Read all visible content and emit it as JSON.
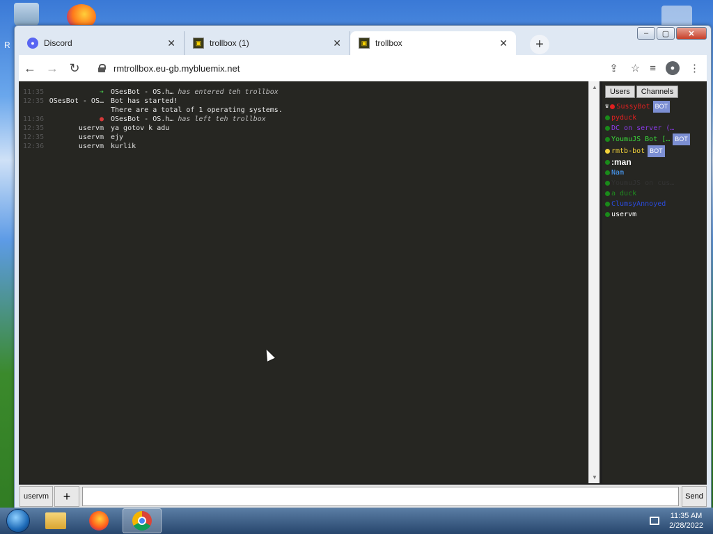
{
  "desktop": {
    "left_letter": "R"
  },
  "browser": {
    "tabs": [
      {
        "title": "Discord",
        "icon": "discord-icon"
      },
      {
        "title": "trollbox (1)",
        "icon": "trollbox-icon"
      },
      {
        "title": "trollbox",
        "icon": "trollbox-icon"
      }
    ],
    "url": "rmtrollbox.eu-gb.mybluemix.net",
    "window_controls": {
      "minimize": "–",
      "maximize": "▢",
      "close": "✕"
    }
  },
  "chat": {
    "messages": [
      {
        "time": "11:35",
        "nick": "➔",
        "text": "OSesBot - OS.h…",
        "suffix": "has entered teh trollbox",
        "type": "join"
      },
      {
        "time": "12:35",
        "nick": "OSesBot - OS…",
        "text": "Bot has started!",
        "suffix": "",
        "type": "msg"
      },
      {
        "time": "",
        "nick": "",
        "text": "There are a total of 1 operating systems.",
        "suffix": "",
        "type": "msg"
      },
      {
        "time": "11:36",
        "nick": "●",
        "text": "OSesBot - OS.h…",
        "suffix": "has left teh trollbox",
        "type": "leave"
      },
      {
        "time": "12:35",
        "nick": "uservm",
        "text": "ya gotov k adu",
        "suffix": "",
        "type": "msg"
      },
      {
        "time": "12:35",
        "nick": "uservm",
        "text": "ejy",
        "suffix": "",
        "type": "msg"
      },
      {
        "time": "12:36",
        "nick": "uservm",
        "text": "kurlik",
        "suffix": "",
        "type": "msg"
      }
    ]
  },
  "sidebar": {
    "tabs": [
      "Users",
      "Channels"
    ],
    "users": [
      {
        "name": "SussyBot",
        "color": "#e02020",
        "dot": "#e02020",
        "bot": true,
        "crown": true
      },
      {
        "name": "pyduck",
        "color": "#e02020",
        "dot": "#1a8a1a",
        "bot": false
      },
      {
        "name": "DC on server (…",
        "color": "#8a3ae8",
        "dot": "#1a8a1a",
        "bot": false
      },
      {
        "name": "YoumuJS Bot […",
        "color": "#3ad83a",
        "dot": "#1a8a1a",
        "bot": true
      },
      {
        "name": "rmtb-bot",
        "color": "#f2d23a",
        "dot": "#f2d23a",
        "bot": true
      },
      {
        "name": ":man",
        "color": "#ffffff",
        "dot": "#1a8a1a",
        "bot": false,
        "big": true
      },
      {
        "name": "Nam",
        "color": "#4aa0ff",
        "dot": "#1a8a1a",
        "bot": false
      },
      {
        "name": "YoumuJS on cus…",
        "color": "#333333",
        "dot": "#1a8a1a",
        "bot": false
      },
      {
        "name": "a duck",
        "color": "#1f8a1f",
        "dot": "#1a8a1a",
        "bot": false
      },
      {
        "name": "ClumsyAnnoyed",
        "color": "#2a4ad8",
        "dot": "#1a8a1a",
        "bot": false
      },
      {
        "name": "uservm",
        "color": "#ffffff",
        "dot": "#1a8a1a",
        "bot": false
      }
    ],
    "bot_label": "BOT"
  },
  "input": {
    "nick": "uservm",
    "plus": "+",
    "send": "Send",
    "value": ""
  },
  "taskbar": {
    "time": "11:35 AM",
    "date": "2/28/2022"
  }
}
